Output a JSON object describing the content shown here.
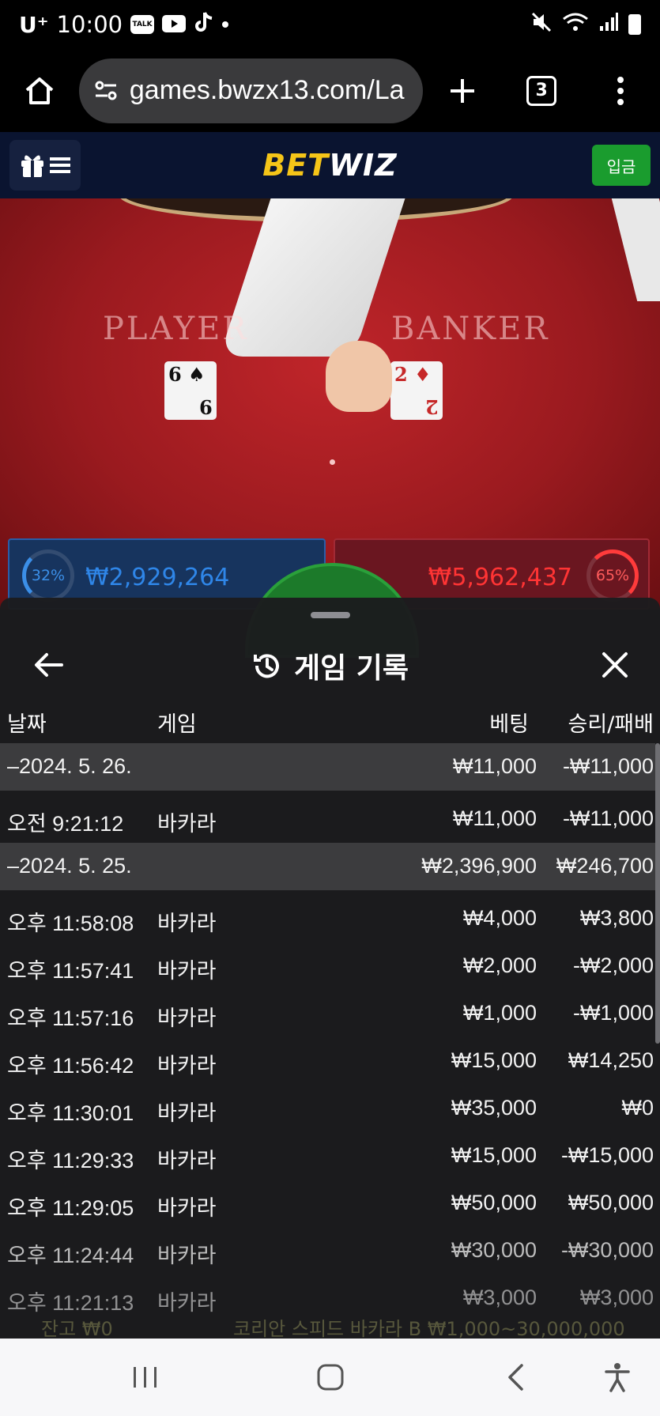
{
  "status_bar": {
    "carrier": "U⁺",
    "time": "10:00",
    "talk_label": "TALK"
  },
  "browser": {
    "url": "games.bwzx13.com/La",
    "tab_count": "3"
  },
  "site": {
    "logo_bet": "BET",
    "logo_wiz": "WIZ",
    "deposit_label": "입금"
  },
  "table": {
    "player_label": "PLAYER",
    "banker_label": "BANKER",
    "player_card_top": "6 ♠",
    "player_card_bottom": "9",
    "banker_card_top": "2 ♦",
    "banker_card_bottom": "2",
    "player_pct": "32%",
    "player_total": "₩2,929,264",
    "banker_pct": "65%",
    "banker_total": "₩5,962,437"
  },
  "history": {
    "title": "게임 기록",
    "columns": {
      "date": "날짜",
      "game": "게임",
      "bet": "베팅",
      "result": "승리/패배"
    },
    "rows": [
      {
        "type": "date",
        "date": "–2024. 5. 26.",
        "game": "",
        "bet": "₩11,000",
        "result": "-₩11,000"
      },
      {
        "type": "entry",
        "date": "오전 9:21:12",
        "game": "바카라",
        "bet": "₩11,000",
        "result": "-₩11,000"
      },
      {
        "type": "date",
        "date": "–2024. 5. 25.",
        "game": "",
        "bet": "₩2,396,900",
        "result": "₩246,700"
      },
      {
        "type": "entry",
        "date": "오후 11:58:08",
        "game": "바카라",
        "bet": "₩4,000",
        "result": "₩3,800"
      },
      {
        "type": "entry",
        "date": "오후 11:57:41",
        "game": "바카라",
        "bet": "₩2,000",
        "result": "-₩2,000"
      },
      {
        "type": "entry",
        "date": "오후 11:57:16",
        "game": "바카라",
        "bet": "₩1,000",
        "result": "-₩1,000"
      },
      {
        "type": "entry",
        "date": "오후 11:56:42",
        "game": "바카라",
        "bet": "₩15,000",
        "result": "₩14,250"
      },
      {
        "type": "entry",
        "date": "오후 11:30:01",
        "game": "바카라",
        "bet": "₩35,000",
        "result": "₩0"
      },
      {
        "type": "entry",
        "date": "오후 11:29:33",
        "game": "바카라",
        "bet": "₩15,000",
        "result": "-₩15,000"
      },
      {
        "type": "entry",
        "date": "오후 11:29:05",
        "game": "바카라",
        "bet": "₩50,000",
        "result": "₩50,000"
      },
      {
        "type": "entry",
        "date": "오후 11:24:44",
        "game": "바카라",
        "bet": "₩30,000",
        "result": "-₩30,000"
      },
      {
        "type": "entry",
        "date": "오후 11:21:13",
        "game": "바카라",
        "bet": "₩3,000",
        "result": "₩3,000"
      }
    ],
    "footer_balance": "잔고 ₩0",
    "footer_table": "코리안 스피드 바카라 B ₩1,000~30,000,000"
  },
  "colors": {
    "accent_green": "#1a9c2e",
    "logo_yellow": "#f5c518",
    "player_blue": "#2f86e8",
    "banker_red": "#ff3434"
  },
  "icons": [
    "wifi-icon",
    "signal-icon",
    "battery-icon",
    "mute-icon",
    "home-icon",
    "site-settings-icon",
    "plus-icon",
    "more-icon",
    "gift-icon",
    "menu-icon",
    "history-icon",
    "back-arrow-icon",
    "close-icon",
    "recents-icon",
    "home-nav-icon",
    "back-nav-icon",
    "accessibility-icon"
  ]
}
